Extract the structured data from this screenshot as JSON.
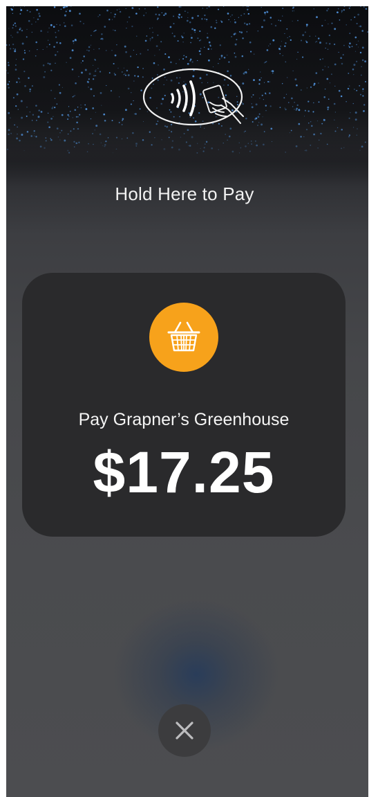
{
  "reader": {
    "icon": "contactless-reader-icon",
    "instruction": "Hold Here to Pay"
  },
  "payment": {
    "merchant_icon": "shopping-basket-icon",
    "merchant_label": "Pay Grapner’s Greenhouse",
    "amount": "$17.25"
  },
  "controls": {
    "close_icon": "close-icon"
  },
  "colors": {
    "accent": "#f7a21b",
    "card": "#2a2a2c",
    "stars": "#4f8fd6"
  }
}
